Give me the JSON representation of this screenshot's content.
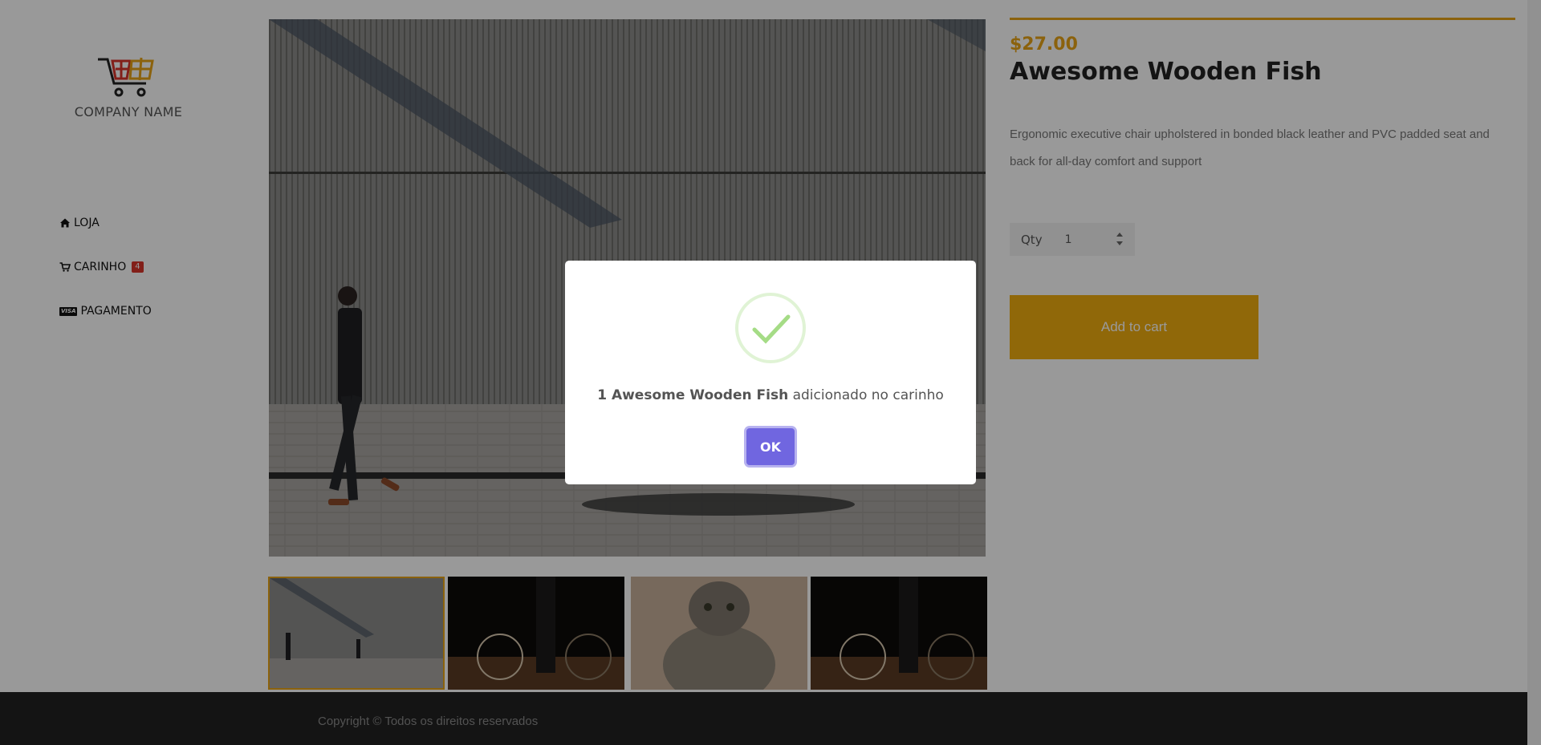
{
  "brand": {
    "company_name": "COMPANY NAME"
  },
  "nav": {
    "items": [
      {
        "label": "LOJA",
        "icon": "home-icon"
      },
      {
        "label": "CARINHO",
        "icon": "cart-icon",
        "badge": "4"
      },
      {
        "label": "PAGAMENTO",
        "icon": "visa-icon",
        "icon_text": "VISA"
      }
    ]
  },
  "product": {
    "price": "$27.00",
    "title": "Awesome Wooden Fish",
    "description": "Ergonomic executive chair upholstered in bonded black leather and PVC padded seat and back for all-day comfort and support",
    "qty_label": "Qty",
    "qty_value": "1",
    "add_to_cart_label": "Add to cart"
  },
  "gallery": {
    "thumbnails": [
      "man-walking-wall",
      "bicycle-dark",
      "cat",
      "bicycle-dark"
    ]
  },
  "footer": {
    "copyright": "Copyright © Todos os direitos reservados"
  },
  "modal": {
    "message_bold": "1 Awesome Wooden Fish",
    "message_rest": " adicionado no carinho",
    "ok_label": "OK"
  },
  "colors": {
    "accent": "#e8a317",
    "button": "#f0ad0f",
    "ok_button": "#7066e0",
    "success": "#a5dc86",
    "badge": "#d9342b",
    "footer": "#222222"
  }
}
